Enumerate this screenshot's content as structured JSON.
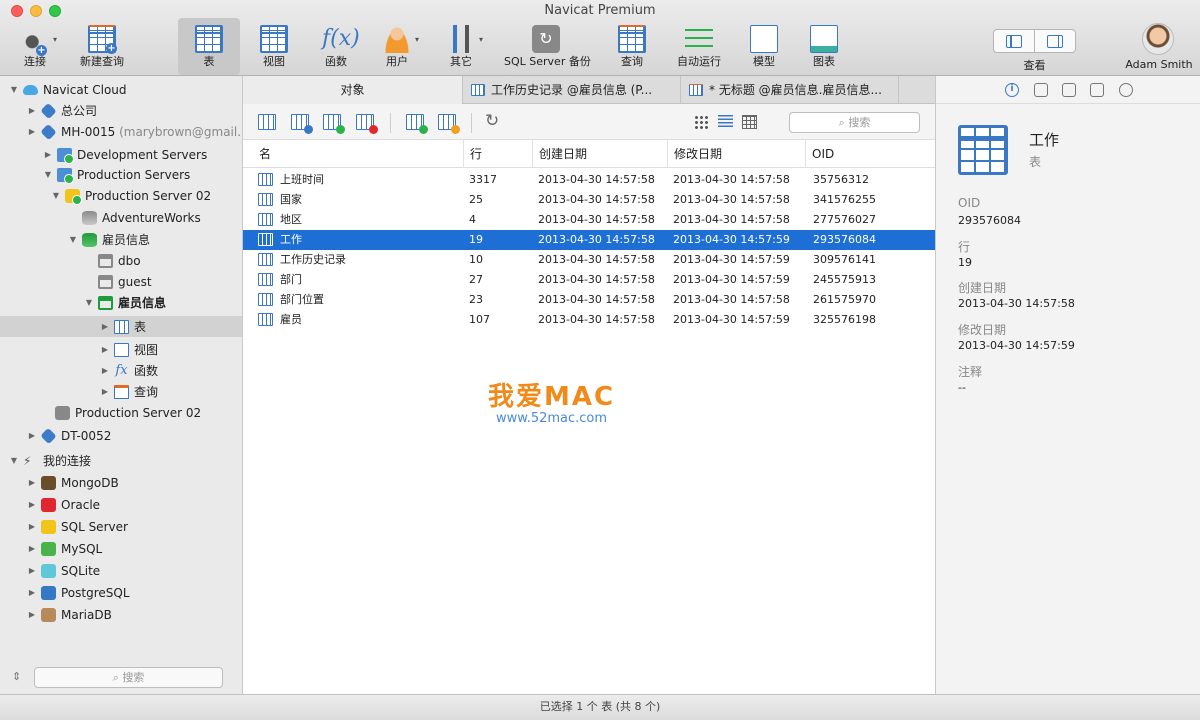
{
  "window": {
    "title": "Navicat Premium"
  },
  "toolbar": {
    "connect": "连接",
    "new_query": "新建查询",
    "table": "表",
    "view": "视图",
    "function": "函数",
    "user": "用户",
    "other": "其它",
    "sqlserver_backup": "SQL Server 备份",
    "query": "查询",
    "automation": "自动运行",
    "model": "模型",
    "chart": "图表",
    "view_mode": "查看",
    "user_name": "Adam Smith"
  },
  "sidebar": {
    "cloud": "Navicat Cloud",
    "head_office": "总公司",
    "mh": "MH-0015",
    "mh_email": "(marybrown@gmail...",
    "dev_servers": "Development Servers",
    "prod_servers": "Production Servers",
    "prod_server_02": "Production Server 02",
    "adventureworks": "AdventureWorks",
    "employee_db": "雇员信息",
    "dbo": "dbo",
    "guest": "guest",
    "employee_schema": "雇员信息",
    "tables": "表",
    "views": "视图",
    "functions": "函数",
    "queries": "查询",
    "prod_server_02b": "Production Server 02",
    "dt": "DT-0052",
    "my_connections": "我的连接",
    "mongodb": "MongoDB",
    "oracle": "Oracle",
    "sqlserver": "SQL Server",
    "mysql": "MySQL",
    "sqlite": "SQLite",
    "postgresql": "PostgreSQL",
    "mariadb": "MariaDB",
    "search_placeholder": "搜索"
  },
  "tabs": {
    "objects": "对象",
    "history": "工作历史记录 @雇员信息 (P...",
    "untitled": "* 无标题 @雇员信息.雇员信息..."
  },
  "objects": {
    "search_placeholder": "搜索",
    "columns": {
      "name": "名",
      "rows": "行",
      "created": "创建日期",
      "modified": "修改日期",
      "oid": "OID"
    },
    "rows": [
      {
        "name": "上班时间",
        "rows": "3317",
        "created": "2013-04-30 14:57:58",
        "modified": "2013-04-30 14:57:58",
        "oid": "35756312"
      },
      {
        "name": "国家",
        "rows": "25",
        "created": "2013-04-30 14:57:58",
        "modified": "2013-04-30 14:57:58",
        "oid": "341576255"
      },
      {
        "name": "地区",
        "rows": "4",
        "created": "2013-04-30 14:57:58",
        "modified": "2013-04-30 14:57:58",
        "oid": "277576027"
      },
      {
        "name": "工作",
        "rows": "19",
        "created": "2013-04-30 14:57:58",
        "modified": "2013-04-30 14:57:59",
        "oid": "293576084"
      },
      {
        "name": "工作历史记录",
        "rows": "10",
        "created": "2013-04-30 14:57:58",
        "modified": "2013-04-30 14:57:59",
        "oid": "309576141"
      },
      {
        "name": "部门",
        "rows": "27",
        "created": "2013-04-30 14:57:58",
        "modified": "2013-04-30 14:57:59",
        "oid": "245575913"
      },
      {
        "name": "部门位置",
        "rows": "23",
        "created": "2013-04-30 14:57:58",
        "modified": "2013-04-30 14:57:58",
        "oid": "261575970"
      },
      {
        "name": "雇员",
        "rows": "107",
        "created": "2013-04-30 14:57:58",
        "modified": "2013-04-30 14:57:59",
        "oid": "325576198"
      }
    ]
  },
  "watermark": {
    "big": "我爱MAC",
    "small": "www.52mac.com"
  },
  "info": {
    "name": "工作",
    "type": "表",
    "oid_label": "OID",
    "oid": "293576084",
    "rows_label": "行",
    "rows": "19",
    "created_label": "创建日期",
    "created": "2013-04-30 14:57:58",
    "modified_label": "修改日期",
    "modified": "2013-04-30 14:57:59",
    "comment_label": "注释",
    "comment": "--"
  },
  "status": {
    "text": "已选择 1 个 表 (共 8 个)"
  }
}
